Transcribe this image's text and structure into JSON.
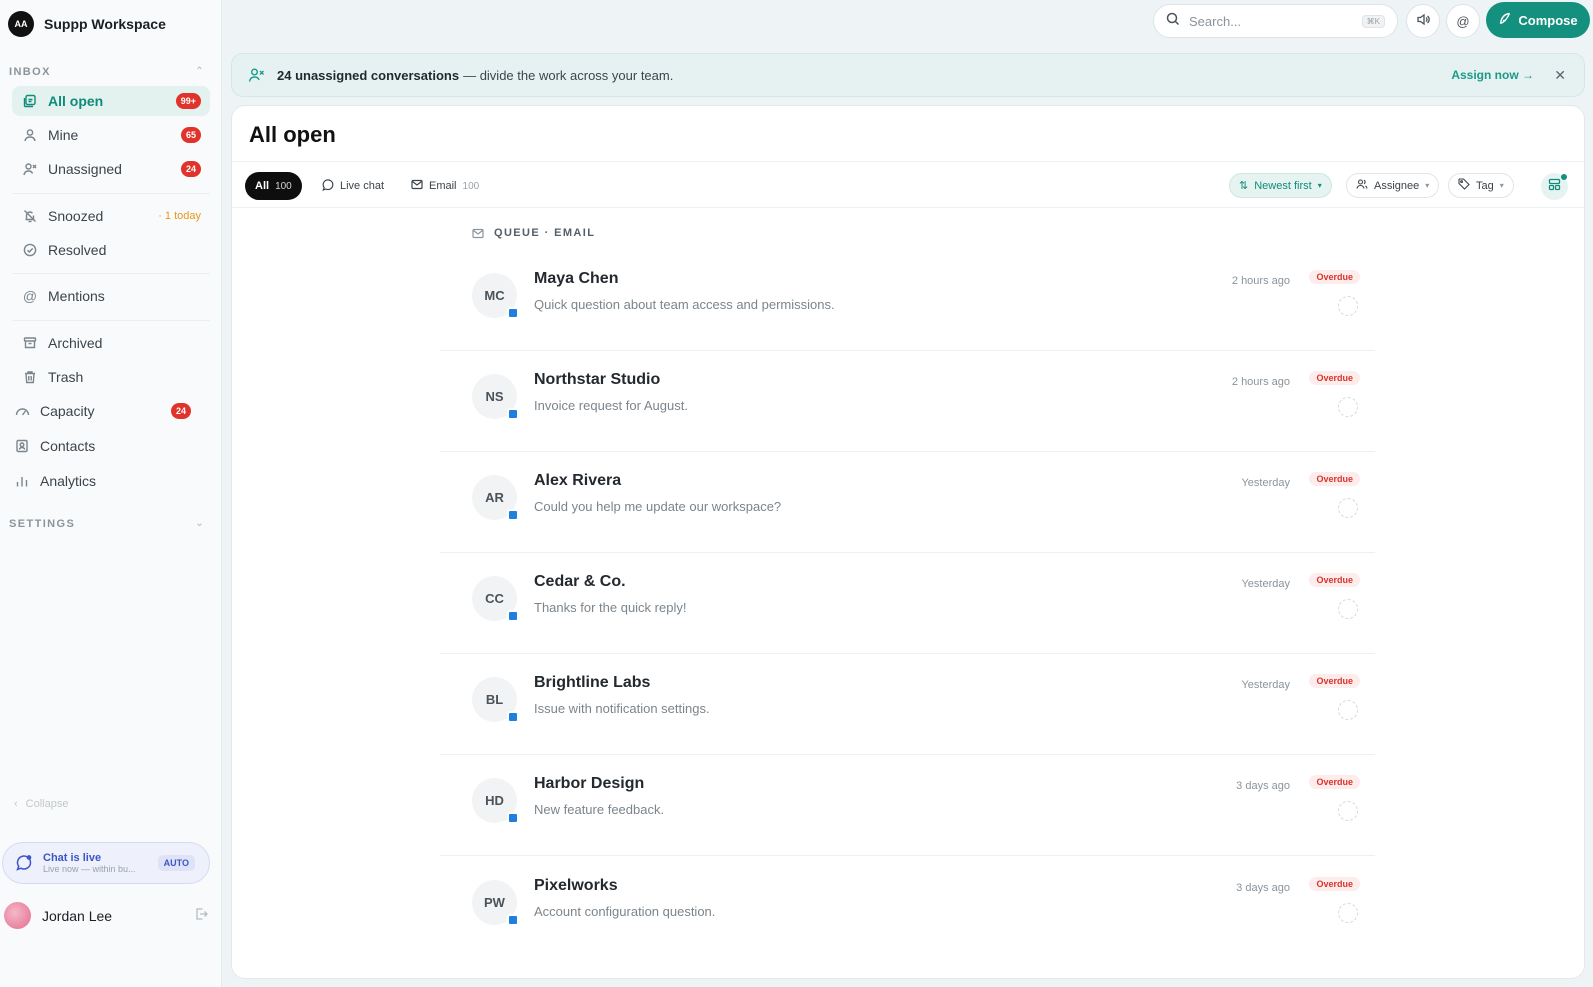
{
  "workspace": {
    "logo_text": "AA",
    "name": "Suppp Workspace"
  },
  "sidebar": {
    "inbox_header": "INBOX",
    "items": [
      {
        "label": "All open",
        "badge": "99+",
        "icon": "inbox-icon"
      },
      {
        "label": "Mine",
        "badge": "65",
        "icon": "user-icon"
      },
      {
        "label": "Unassigned",
        "badge": "24",
        "icon": "user-x-icon"
      },
      {
        "label": "Snoozed",
        "note": "· 1 today",
        "icon": "bell-off-icon"
      },
      {
        "label": "Resolved",
        "icon": "check-circle-icon"
      },
      {
        "label": "Mentions",
        "icon": "at-icon"
      },
      {
        "label": "Archived",
        "icon": "archive-icon"
      },
      {
        "label": "Trash",
        "icon": "trash-icon"
      },
      {
        "label": "Capacity",
        "badge": "24",
        "icon": "gauge-icon"
      },
      {
        "label": "Contacts",
        "icon": "contacts-icon"
      },
      {
        "label": "Analytics",
        "icon": "bar-chart-icon"
      }
    ],
    "settings_header": "SETTINGS",
    "collapse_label": "Collapse",
    "chat_status": {
      "title": "Chat is live",
      "subtitle": "Live now — within bu...",
      "mode": "AUTO"
    },
    "user": {
      "name": "Jordan Lee"
    }
  },
  "topbar": {
    "search_placeholder": "Search...",
    "search_shortcut": "⌘K",
    "compose_label": "Compose"
  },
  "banner": {
    "bold_text": "24 unassigned conversations",
    "text": "— divide the work across your team.",
    "action_label": "Assign now →"
  },
  "main": {
    "title": "All open",
    "filters": [
      {
        "label": "All",
        "count": "100"
      },
      {
        "label": "Live chat",
        "count": ""
      },
      {
        "label": "Email",
        "count": "100"
      }
    ],
    "sort_label": "Newest first",
    "assignee_label": "Assignee",
    "tag_label": "Tag",
    "queue_header": "QUEUE · EMAIL",
    "conversations": [
      {
        "initials": "MC",
        "name": "Maya Chen",
        "preview": "Quick question about team access and permissions.",
        "time": "2 hours ago",
        "status": "Overdue"
      },
      {
        "initials": "NS",
        "name": "Northstar Studio",
        "preview": "Invoice request for August.",
        "time": "2 hours ago",
        "status": "Overdue"
      },
      {
        "initials": "AR",
        "name": "Alex Rivera",
        "preview": "Could you help me update our workspace?",
        "time": "Yesterday",
        "status": "Overdue"
      },
      {
        "initials": "CC",
        "name": "Cedar & Co.",
        "preview": "Thanks for the quick reply!",
        "time": "Yesterday",
        "status": "Overdue"
      },
      {
        "initials": "BL",
        "name": "Brightline Labs",
        "preview": "Issue with notification settings.",
        "time": "Yesterday",
        "status": "Overdue"
      },
      {
        "initials": "HD",
        "name": "Harbor Design",
        "preview": "New feature feedback.",
        "time": "3 days ago",
        "status": "Overdue"
      },
      {
        "initials": "PW",
        "name": "Pixelworks",
        "preview": "Account configuration question.",
        "time": "3 days ago",
        "status": "Overdue"
      }
    ]
  },
  "colors": {
    "accent": "#14907f",
    "badge": "#e0332b",
    "overdue": "#d9342b",
    "chat": "#3e55c6"
  }
}
